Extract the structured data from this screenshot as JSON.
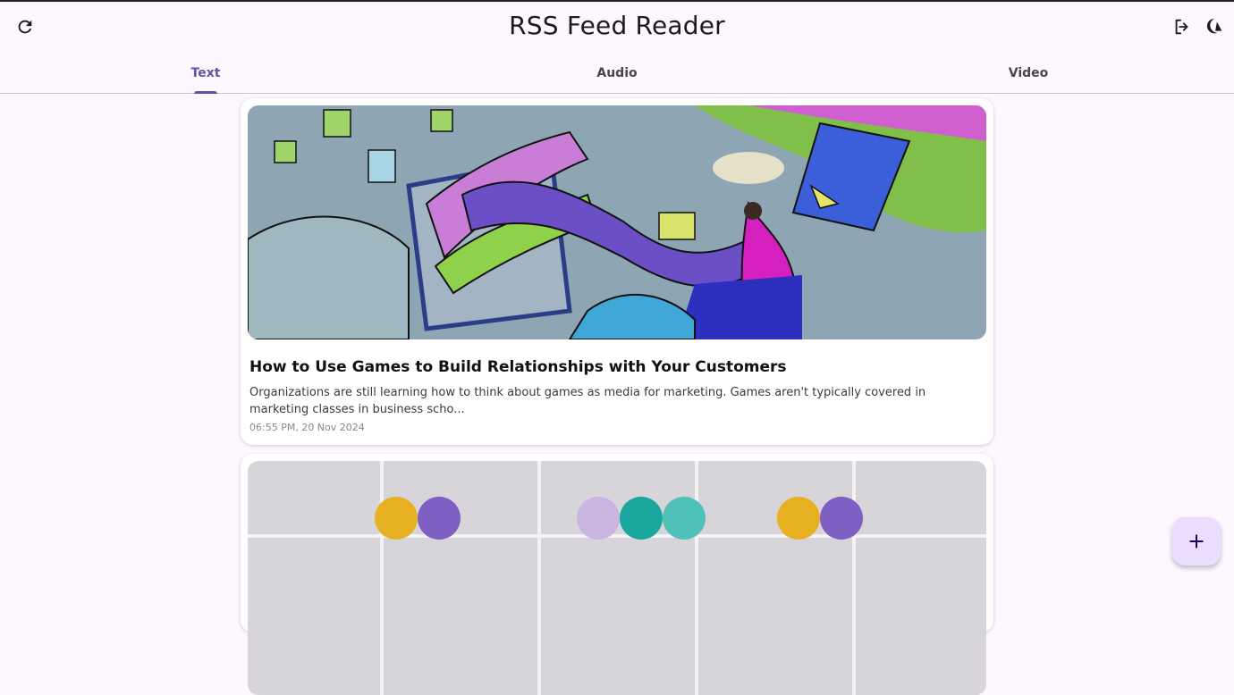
{
  "app": {
    "title": "RSS Feed Reader"
  },
  "tabs": [
    {
      "label": "Text",
      "active": true
    },
    {
      "label": "Audio",
      "active": false
    },
    {
      "label": "Video",
      "active": false
    }
  ],
  "actions": {
    "refresh_icon": "refresh-icon",
    "logout_icon": "logout-icon",
    "theme_icon": "dark-mode-icon",
    "add_icon": "plus-icon"
  },
  "colors": {
    "accent": "#6750a4",
    "background": "#fdf7ff",
    "fab": "#eaddff"
  },
  "feed": {
    "items": [
      {
        "title": "How to Use Games to Build Relationships with Your Customers",
        "description": "Organizations are still learning how to think about games as media for marketing. Games aren't typically covered in marketing classes in business scho...",
        "date": "06:55 PM, 20 Nov 2024"
      },
      {
        "title": "",
        "description": "",
        "date": ""
      }
    ]
  }
}
